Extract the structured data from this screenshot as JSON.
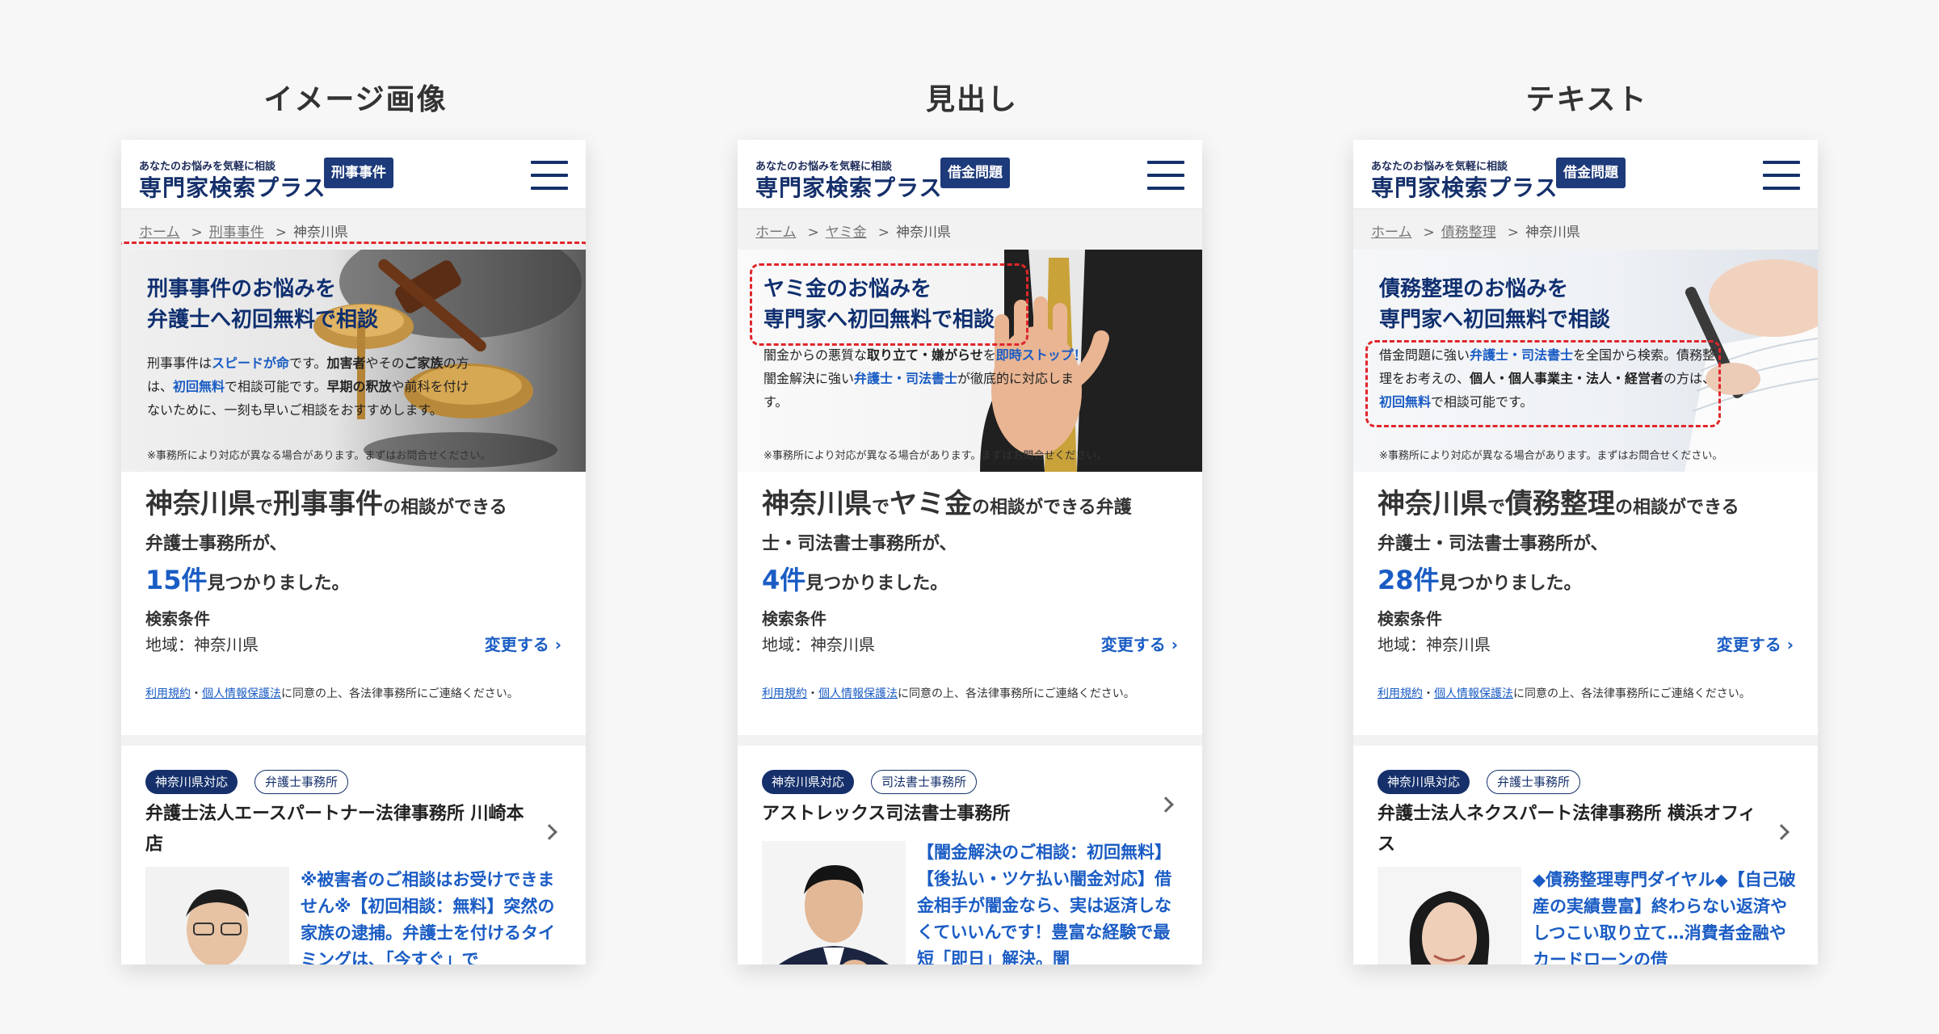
{
  "column_titles": [
    "イメージ画像",
    "見出し",
    "テキスト"
  ],
  "header": {
    "logo_tagline": "あなたのお悩みを気軽に相談",
    "logo_name": "専門家検索プラス"
  },
  "breadcrumb": {
    "home": "ホーム",
    "sep": ">",
    "region": "神奈川県"
  },
  "common": {
    "hero_note": "※事務所により対応が異なる場合があります。まずはお問合せください。",
    "count_suffix": "見つかりました。",
    "condition_label": "検索条件",
    "condition_value": "地域：神奈川県",
    "change_label": "変更する",
    "terms_link": "利用規約",
    "privacy_link": "個人情報保護法",
    "agree_text": "に同意の上、各法律事務所にご連絡ください。",
    "region_tag": "神奈川県対応"
  },
  "screens": [
    {
      "category_badge": "刑事事件",
      "crumb_category": "刑事事件",
      "hero_title_1": "刑事事件のお悩みを",
      "hero_title_2": "弁護士へ初回無料で相談",
      "hero_t1": "刑事事件は",
      "hero_t2": "スピードが命",
      "hero_t3": "です。",
      "hero_t4": "加害者",
      "hero_t5": "やその",
      "hero_t6": "ご家族",
      "hero_t7": "の方は、",
      "hero_t8": "初回無料",
      "hero_t9": "で相談可能です。",
      "hero_t10": "早期の釈放",
      "hero_t11": "や前科を付けないために、一刻も早いご相談をおすすめします。",
      "result_pref": "神奈川県",
      "result_de": "で",
      "result_category": "刑事事件",
      "result_tail": "の相談ができる",
      "result_line2": "弁護士事務所が、",
      "result_count": "15件",
      "office_type_tag": "弁護士事務所",
      "office_name": "弁護士法人エースパートナー法律事務所 川崎本店",
      "office_pr": "※被害者のご相談はお受けできません※【初回相談：無料】突然の家族の逮捕。弁護士を付けるタイミングは、「今すぐ」で"
    },
    {
      "category_badge": "借金問題",
      "crumb_category": "ヤミ金",
      "hero_title_1": "ヤミ金のお悩みを",
      "hero_title_2": "専門家へ初回無料で相談",
      "hero_t1": "闇金からの悪質な",
      "hero_t2": "取り立て・嫌がらせ",
      "hero_t3": "を",
      "hero_t4": "即時ストップ！",
      "hero_t5": "闇金解決に強い",
      "hero_t6": "弁護士・司法書士",
      "hero_t7": "が徹底的に対応します。",
      "result_pref": "神奈川県",
      "result_de": "で",
      "result_category": "ヤミ金",
      "result_tail": "の相談ができる弁護",
      "result_line2": "士・司法書士事務所が、",
      "result_count": "4件",
      "office_type_tag": "司法書士事務所",
      "office_name": "アストレックス司法書士事務所",
      "office_pr": "【闇金解決のご相談：初回無料】【後払い・ツケ払い闇金対応】借金相手が闇金なら、実は返済しなくていいんです！豊富な経験で最短「即日」解決。闇"
    },
    {
      "category_badge": "借金問題",
      "crumb_category": "債務整理",
      "hero_title_1": "債務整理のお悩みを",
      "hero_title_2": "専門家へ初回無料で相談",
      "hero_t1": "借金問題に強い",
      "hero_t2": "弁護士・司法書士",
      "hero_t3": "を全国から検索。債務整理をお考えの、",
      "hero_t4": "個人・個人事業主・法人・経営者",
      "hero_t5": "の方は、",
      "hero_t6": "初回無料",
      "hero_t7": "で相談可能です。",
      "result_pref": "神奈川県",
      "result_de": "で",
      "result_category": "債務整理",
      "result_tail": "の相談ができる",
      "result_line2": "弁護士・司法書士事務所が、",
      "result_count": "28件",
      "office_type_tag": "弁護士事務所",
      "office_name": "弁護士法人ネクスパート法律事務所 横浜オフィス",
      "office_pr": "◆債務整理専門ダイヤル◆【自己破産の実績豊富】終わらない返済やしつこい取り立て…消費者金融やカードローンの借"
    }
  ],
  "colors": {
    "navy": "#15306b",
    "accent_blue": "#1a5cc4",
    "highlight_red": "#e0262b"
  }
}
